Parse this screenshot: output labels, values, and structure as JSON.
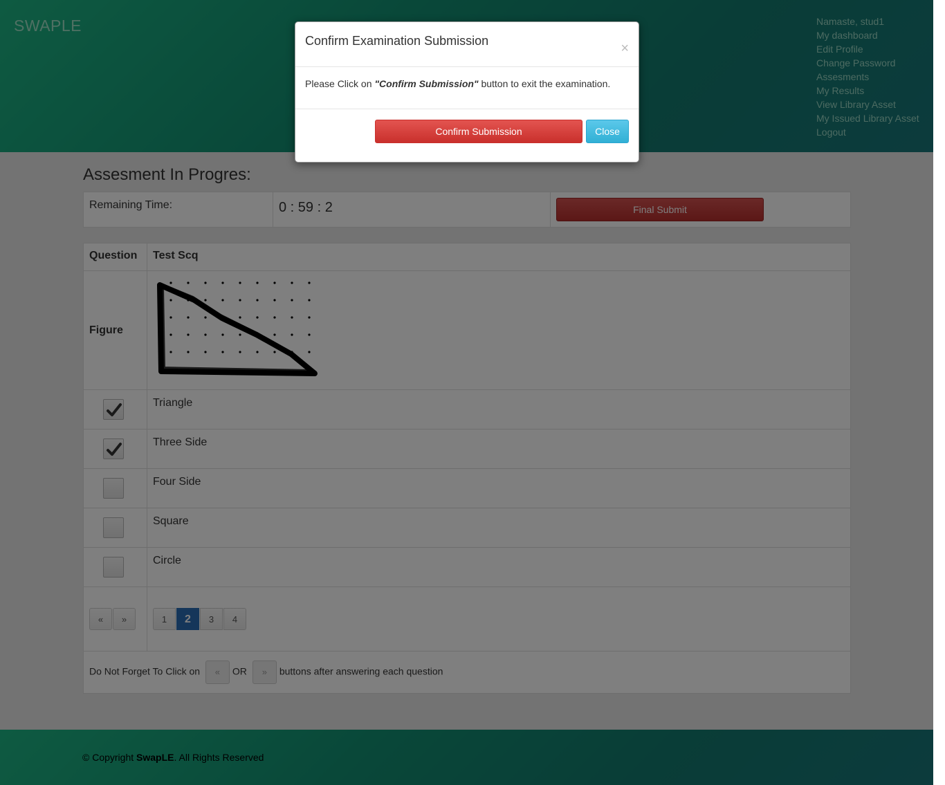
{
  "header": {
    "brand": "SWAPLE",
    "nav": [
      "Namaste, stud1",
      "My dashboard",
      "Edit Profile",
      "Change Password",
      "Assesments",
      "My Results",
      "View Library Asset",
      "My Issued Library Asset",
      "Logout"
    ]
  },
  "assessment": {
    "title": "Assesment In Progres:",
    "remaining_label": "Remaining Time:",
    "remaining_time": "0 : 59 : 2",
    "final_submit_label": "Final Submit"
  },
  "question": {
    "header_label": "Question",
    "header_title": "Test Scq",
    "figure_label": "Figure",
    "options": [
      {
        "label": "Triangle",
        "checked": true
      },
      {
        "label": "Three Side",
        "checked": true
      },
      {
        "label": "Four Side",
        "checked": false
      },
      {
        "label": "Square",
        "checked": false
      },
      {
        "label": "Circle",
        "checked": false
      }
    ],
    "prev_label": "«",
    "next_label": "»",
    "pages": [
      "1",
      "2",
      "3",
      "4"
    ],
    "current_page": "2",
    "hint_prefix": "Do Not Forget To Click on",
    "hint_or": "OR",
    "hint_suffix": "buttons after answering each question"
  },
  "footer": {
    "copyright_prefix": "© Copyright",
    "brand": "SwapLE",
    "copyright_suffix": ". All Rights Reserved"
  },
  "modal": {
    "title": "Confirm Examination Submission",
    "close_symbol": "×",
    "body_prefix": "Please Click on",
    "body_emphasis": "\"Confirm Submission\"",
    "body_suffix": "button to exit the examination.",
    "confirm_label": "Confirm Submission",
    "close_label": "Close"
  },
  "colors": {
    "header_accent": "#1db584",
    "danger": "#c9302c",
    "info": "#31b0d5",
    "page_active": "#2a6db5"
  }
}
